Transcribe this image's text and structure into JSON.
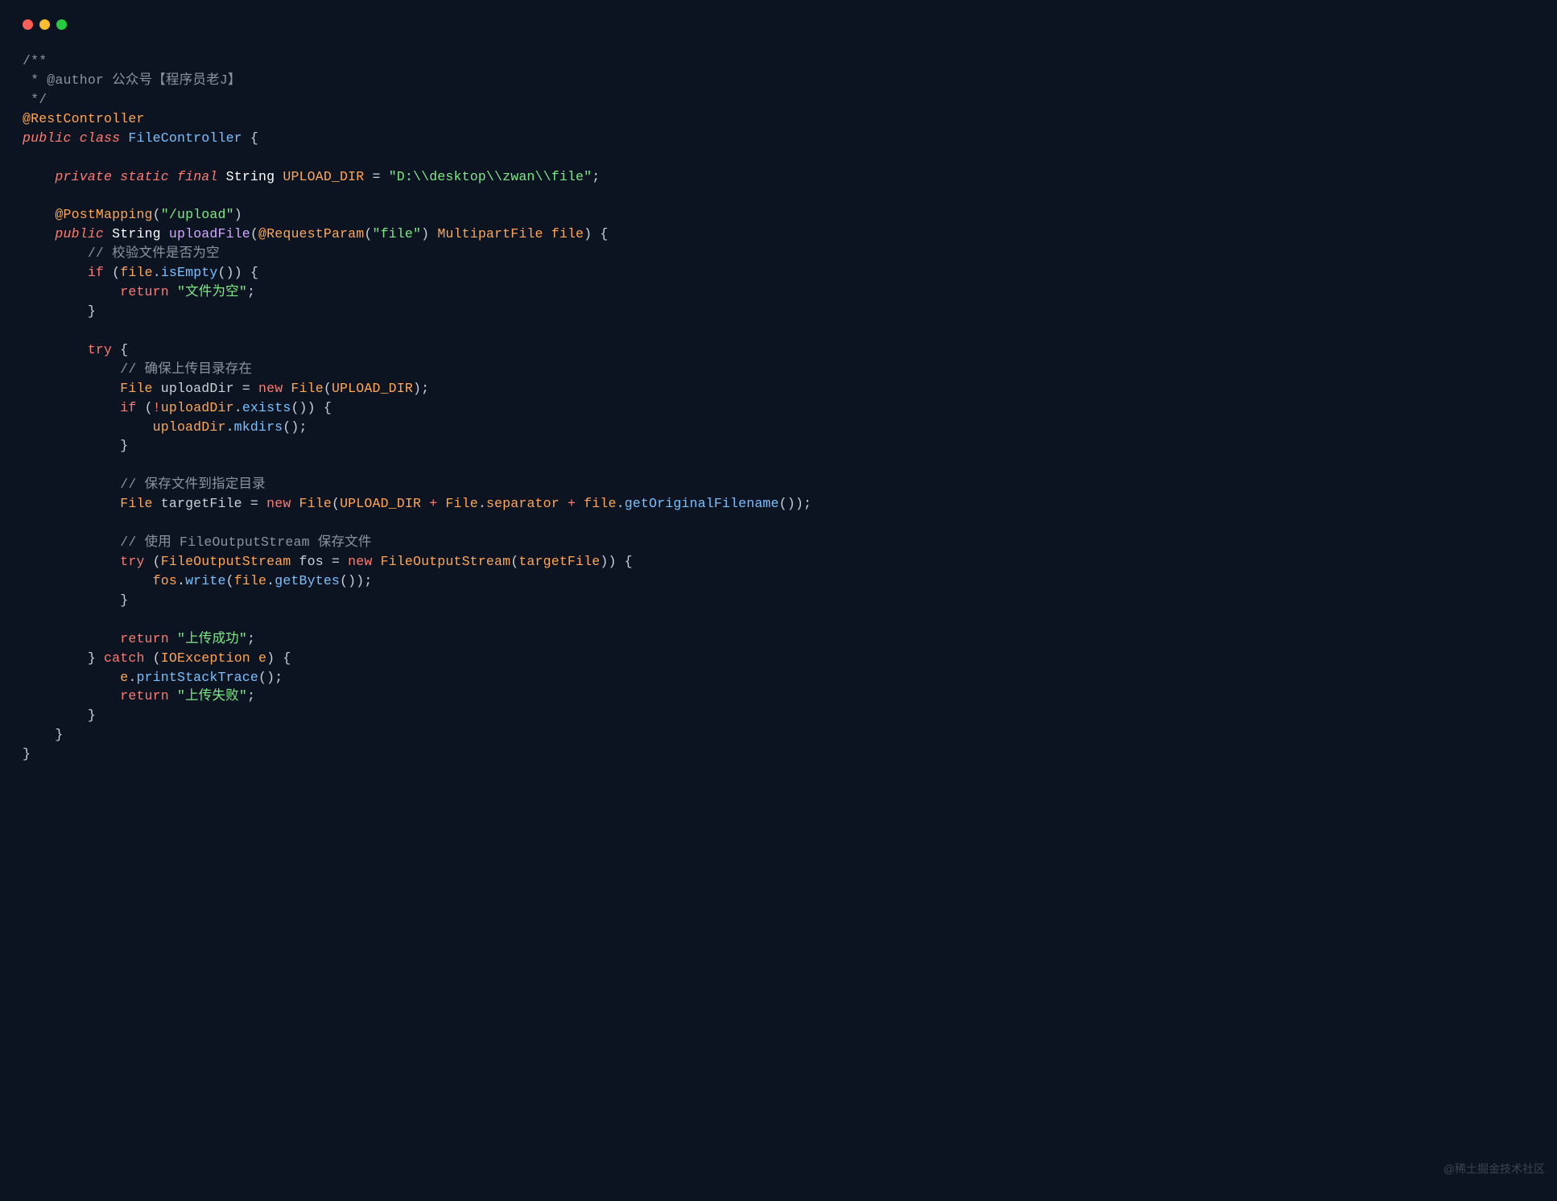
{
  "window": {
    "titlebar": {
      "buttons": [
        "close",
        "minimize",
        "maximize"
      ]
    }
  },
  "code": {
    "comment_open": "/**",
    "comment_author": " * @author 公众号【程序员老J】",
    "comment_close": " */",
    "anno_rest": "@RestController",
    "kw_public": "public",
    "kw_class": "class",
    "class_name": "FileController",
    "brace_open": " {",
    "kw_private": "private",
    "kw_static": "static",
    "kw_final": "final",
    "type_string": "String",
    "const_upload_dir": "UPLOAD_DIR",
    "eq": " = ",
    "str_path": "\"D:\\\\desktop\\\\zwan\\\\file\"",
    "semi": ";",
    "anno_post": "@PostMapping",
    "str_upload": "\"/upload\"",
    "method_upload": "uploadFile",
    "anno_req_param": "@RequestParam",
    "str_file": "\"file\"",
    "type_multipart": "MultipartFile",
    "param_file": "file",
    "comment_check": "// 校验文件是否为空",
    "kw_if": "if",
    "method_isempty": "isEmpty",
    "kw_return": "return",
    "str_empty": "\"文件为空\"",
    "brace_close": "}",
    "kw_try": "try",
    "comment_ensure": "// 确保上传目录存在",
    "type_file": "File",
    "var_uploaddir": "uploadDir",
    "kw_new": "new",
    "method_exists": "exists",
    "method_mkdirs": "mkdirs",
    "comment_save": "// 保存文件到指定目录",
    "var_targetfile": "targetFile",
    "prop_separator": "separator",
    "method_getorigfile": "getOriginalFilename",
    "comment_fos": "// 使用 FileOutputStream 保存文件",
    "type_fos": "FileOutputStream",
    "var_fos": "fos",
    "method_write": "write",
    "method_getbytes": "getBytes",
    "str_success": "\"上传成功\"",
    "kw_catch": "catch",
    "type_ioex": "IOException",
    "param_e": "e",
    "method_printstack": "printStackTrace",
    "str_fail": "\"上传失败\"",
    "plus": " + ",
    "dot": ".",
    "not": "!",
    "paren_open": "(",
    "paren_close": ")"
  },
  "watermark": "@稀土掘金技术社区"
}
